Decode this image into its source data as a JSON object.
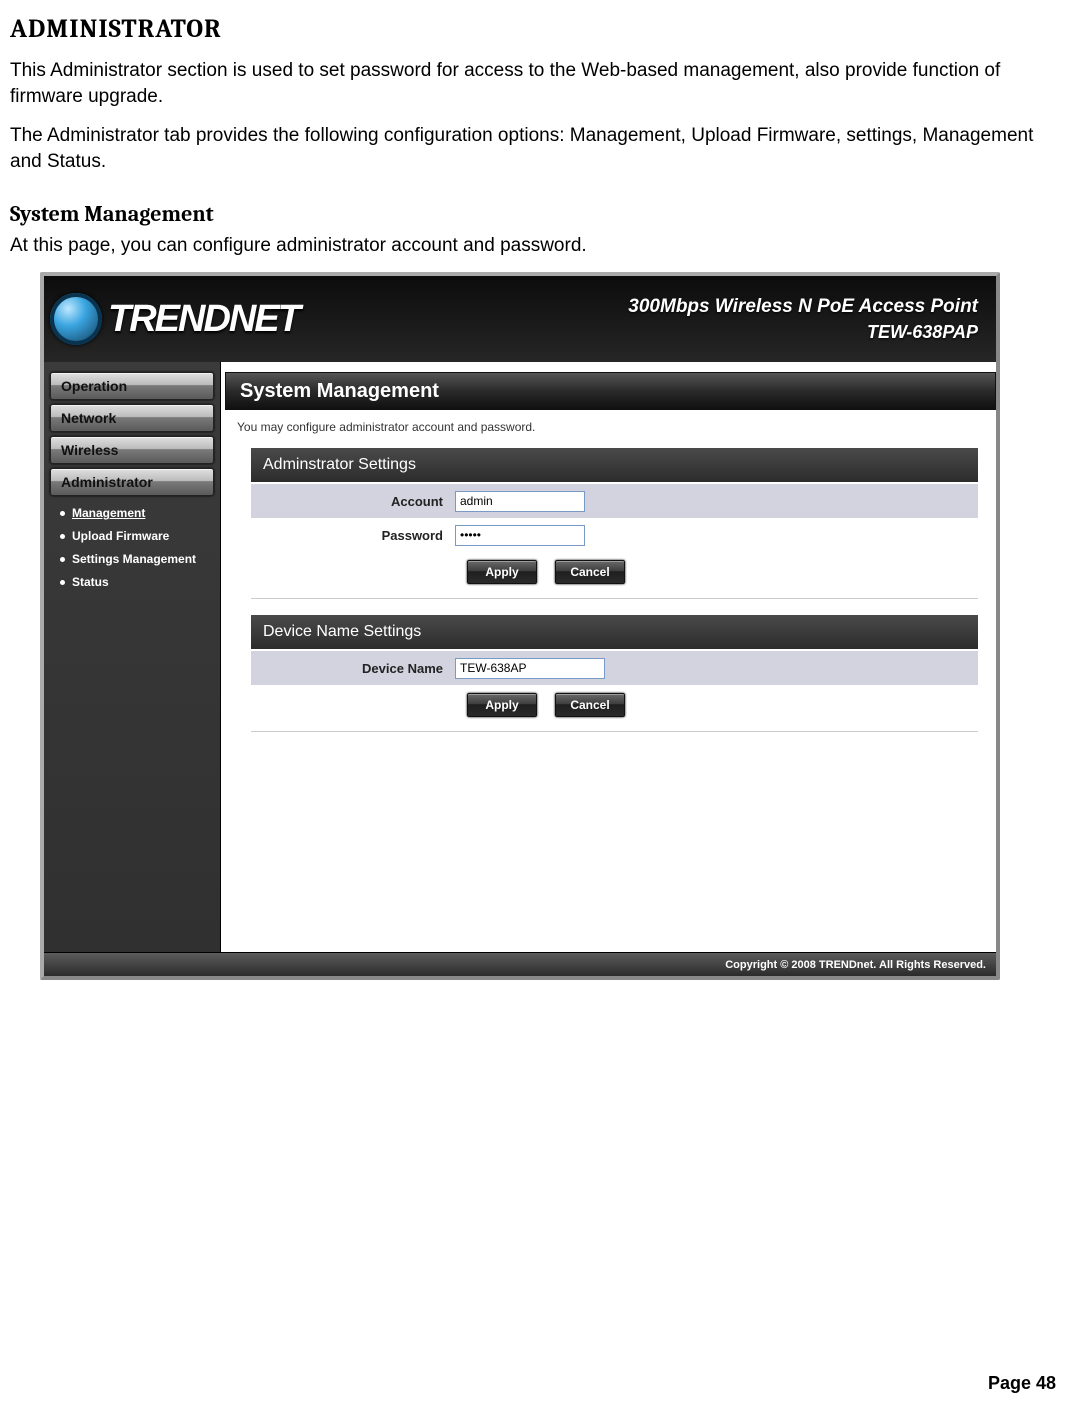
{
  "doc": {
    "title": "ADMINISTRATOR",
    "intro1": "This Administrator section is used to set password for access to the Web-based management, also provide function of firmware upgrade.",
    "intro2": "The Administrator tab provides the following configuration options: Management, Upload Firmware, settings, Management and Status.",
    "section_title": "System Management",
    "section_intro": "At this page, you can configure administrator account and password.",
    "page_number": "Page 48"
  },
  "router": {
    "brand": "TRENDNET",
    "product_line1": "300Mbps Wireless N PoE Access Point",
    "product_line2": "TEW-638PAP",
    "nav": {
      "operation": "Operation",
      "network": "Network",
      "wireless": "Wireless",
      "administrator": "Administrator"
    },
    "subnav": [
      {
        "label": "Management",
        "active": true
      },
      {
        "label": "Upload Firmware",
        "active": false
      },
      {
        "label": "Settings Management",
        "active": false
      },
      {
        "label": "Status",
        "active": false
      }
    ],
    "panel": {
      "title": "System Management",
      "desc": "You may configure administrator account and password."
    },
    "admin_settings": {
      "header": "Adminstrator Settings",
      "account_label": "Account",
      "account_value": "admin",
      "password_label": "Password",
      "password_value": "•••••",
      "apply": "Apply",
      "cancel": "Cancel"
    },
    "device_settings": {
      "header": "Device Name Settings",
      "name_label": "Device Name",
      "name_value": "TEW-638AP",
      "apply": "Apply",
      "cancel": "Cancel"
    },
    "footer": "Copyright © 2008 TRENDnet. All Rights Reserved."
  }
}
